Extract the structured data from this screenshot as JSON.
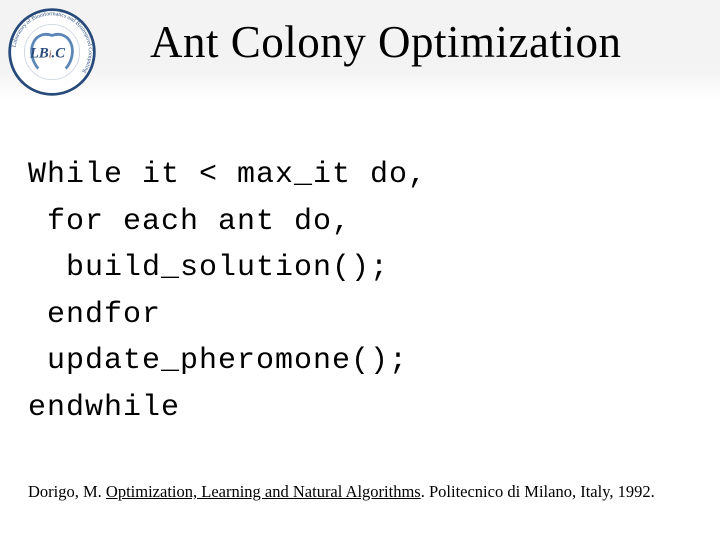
{
  "title": "Ant Colony Optimization",
  "code": {
    "l1": "While it < max_it do,",
    "l2": " for each ant do,",
    "l3": "  build_solution();",
    "l4": " endfor",
    "l5": " update_pheromone();",
    "l6": "endwhile"
  },
  "citation": {
    "author": "Dorigo, M. ",
    "title_underlined": "Optimization, Learning and Natural Algorithms",
    "rest": ". Politecnico di Milano, Italy, 1992."
  },
  "logo": {
    "label": "LBiC",
    "ring_text": "Laboratory of Bioinformatics and Bioinspired Computing"
  }
}
